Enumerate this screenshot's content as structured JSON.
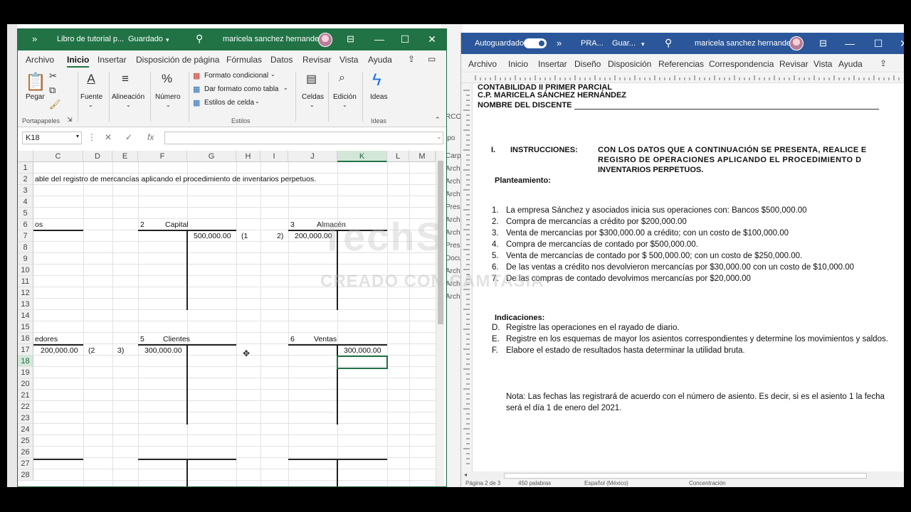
{
  "excel": {
    "title": "Libro de tutorial p...",
    "saved_state": "Guardado",
    "user": "maricela sanchez hernandez",
    "menu": [
      "Archivo",
      "Inicio",
      "Insertar",
      "Disposición de página",
      "Fórmulas",
      "Datos",
      "Revisar",
      "Vista",
      "Ayuda"
    ],
    "ribbon": {
      "pegar": "Pegar",
      "portapapeles": "Portapapeles",
      "fuente": "Fuente",
      "alineacion": "Alineación",
      "numero": "Número",
      "formato_condicional": "Formato condicional",
      "dar_formato": "Dar formato como tabla",
      "estilos_celda": "Estilos de celda",
      "estilos": "Estilos",
      "celdas": "Celdas",
      "edicion": "Edición",
      "ideas_btn": "Ideas",
      "ideas_group": "Ideas"
    },
    "name_box": "K18",
    "fx_label": "fx",
    "columns": [
      "C",
      "D",
      "E",
      "F",
      "G",
      "H",
      "I",
      "J",
      "K",
      "L",
      "M"
    ],
    "rows": [
      "1",
      "2",
      "3",
      "4",
      "5",
      "6",
      "7",
      "8",
      "9",
      "10",
      "11",
      "12",
      "13",
      "14",
      "15",
      "16",
      "17",
      "18",
      "19",
      "20",
      "21",
      "22",
      "23",
      "24",
      "25",
      "26",
      "27",
      "28"
    ],
    "cells": {
      "r2_text": "able del registro de mercancías aplicando el procedimiento de inventarios perpetuos.",
      "r6_c": "os",
      "r6_f_num": "2",
      "r6_f_name": "Capital",
      "r6_j_num": "3",
      "r6_j_name": "Almacén",
      "r7_g": "500,000.00",
      "r7_h": "(1",
      "r7_i": "2)",
      "r7_j": "200,000.00",
      "r16_c": "edores",
      "r16_f_num": "5",
      "r16_f_name": "Clientes",
      "r16_j_num": "6",
      "r16_j_name": "Ventas",
      "r17_c": "200,000.00",
      "r17_d": "(2",
      "r17_e": "3)",
      "r17_f": "300,000.00",
      "r17_k": "300,000.00"
    }
  },
  "word": {
    "autosave": "Autoguardado",
    "doc_title": "PRA...",
    "saved_state": "Guar...",
    "user": "maricela sanchez hernandez",
    "menu": [
      "Archivo",
      "Inicio",
      "Insertar",
      "Diseño",
      "Disposición",
      "Referencias",
      "Correspondencia",
      "Revisar",
      "Vista",
      "Ayuda"
    ],
    "header_line1": "CONTABILIDAD II PRIMER PARCIAL",
    "header_line2": "C.P. MARICELA SÁNCHEZ HERNÁNDEZ",
    "header_line3": "NOMBRE DEL DISCENTE",
    "section_num": "I.",
    "section_title": "INSTRUCCIONES:",
    "instr_line1": "CON LOS DATOS QUE A CONTINUACIÓN SE PRESENTA, REALICE E",
    "instr_line2": "REGISRO DE OPERACIONES APLICANDO EL PROCEDIMIENTO D",
    "instr_line3": "INVENTARIOS PERPETUOS.",
    "planteamiento": "Planteamiento:",
    "items": [
      {
        "n": "1.",
        "text": "La empresa Sánchez y asociados inicia sus operaciones con: Bancos $500,000.00"
      },
      {
        "n": "2.",
        "text": "Compra de mercancías a crédito por $200,000.00"
      },
      {
        "n": "3.",
        "text": "Venta de mercancías por $300,000.00 a crédito; con un costo de $100,000.00"
      },
      {
        "n": "4.",
        "text": "Compra de mercancías de contado por $500,000.00."
      },
      {
        "n": "5.",
        "text": "Venta de mercancías de contado por $ 500,000.00; con un costo de $250,000.00."
      },
      {
        "n": "6.",
        "text": "De las ventas a crédito nos devolvieron mercancías por $30,000.00 con un costo de $10,000.00"
      },
      {
        "n": "7.",
        "text": "De las compras de contado devolvimos mercancías por $20,000.00"
      }
    ],
    "indicaciones": "Indicaciones:",
    "ind_items": [
      {
        "n": "D.",
        "text": "Registre las operaciones en el rayado de diario."
      },
      {
        "n": "E.",
        "text": "Registre en los esquemas de mayor los asientos correspondientes y determine los movimientos y saldos."
      },
      {
        "n": "F.",
        "text": "Elabore el estado de resultados hasta determinar la utilidad bruta."
      }
    ],
    "note_line1": "Nota: Las fechas las registrará de acuerdo con el número de asiento. Es decir, si es el asiento 1 la fecha",
    "note_line2": "será el día 1 de enero del 2021.",
    "status_page": "Página 2 de 3",
    "status_words": "450 palabras",
    "status_lang": "Español (México)",
    "status_focus": "Concentración"
  },
  "background": {
    "labels": [
      "Carpe",
      "Archi",
      "Archi",
      "Archi",
      "Prese",
      "Archi",
      "Archi",
      "Prese",
      "Docu",
      "Archi",
      "Archi",
      "Archi",
      "Archi",
      "RCON",
      "ipo"
    ]
  },
  "watermark": {
    "big": "TechS",
    "small": "CREADO CON CAMTASIA"
  },
  "colors": {
    "excel_green": "#217346",
    "word_blue": "#2b579a"
  }
}
